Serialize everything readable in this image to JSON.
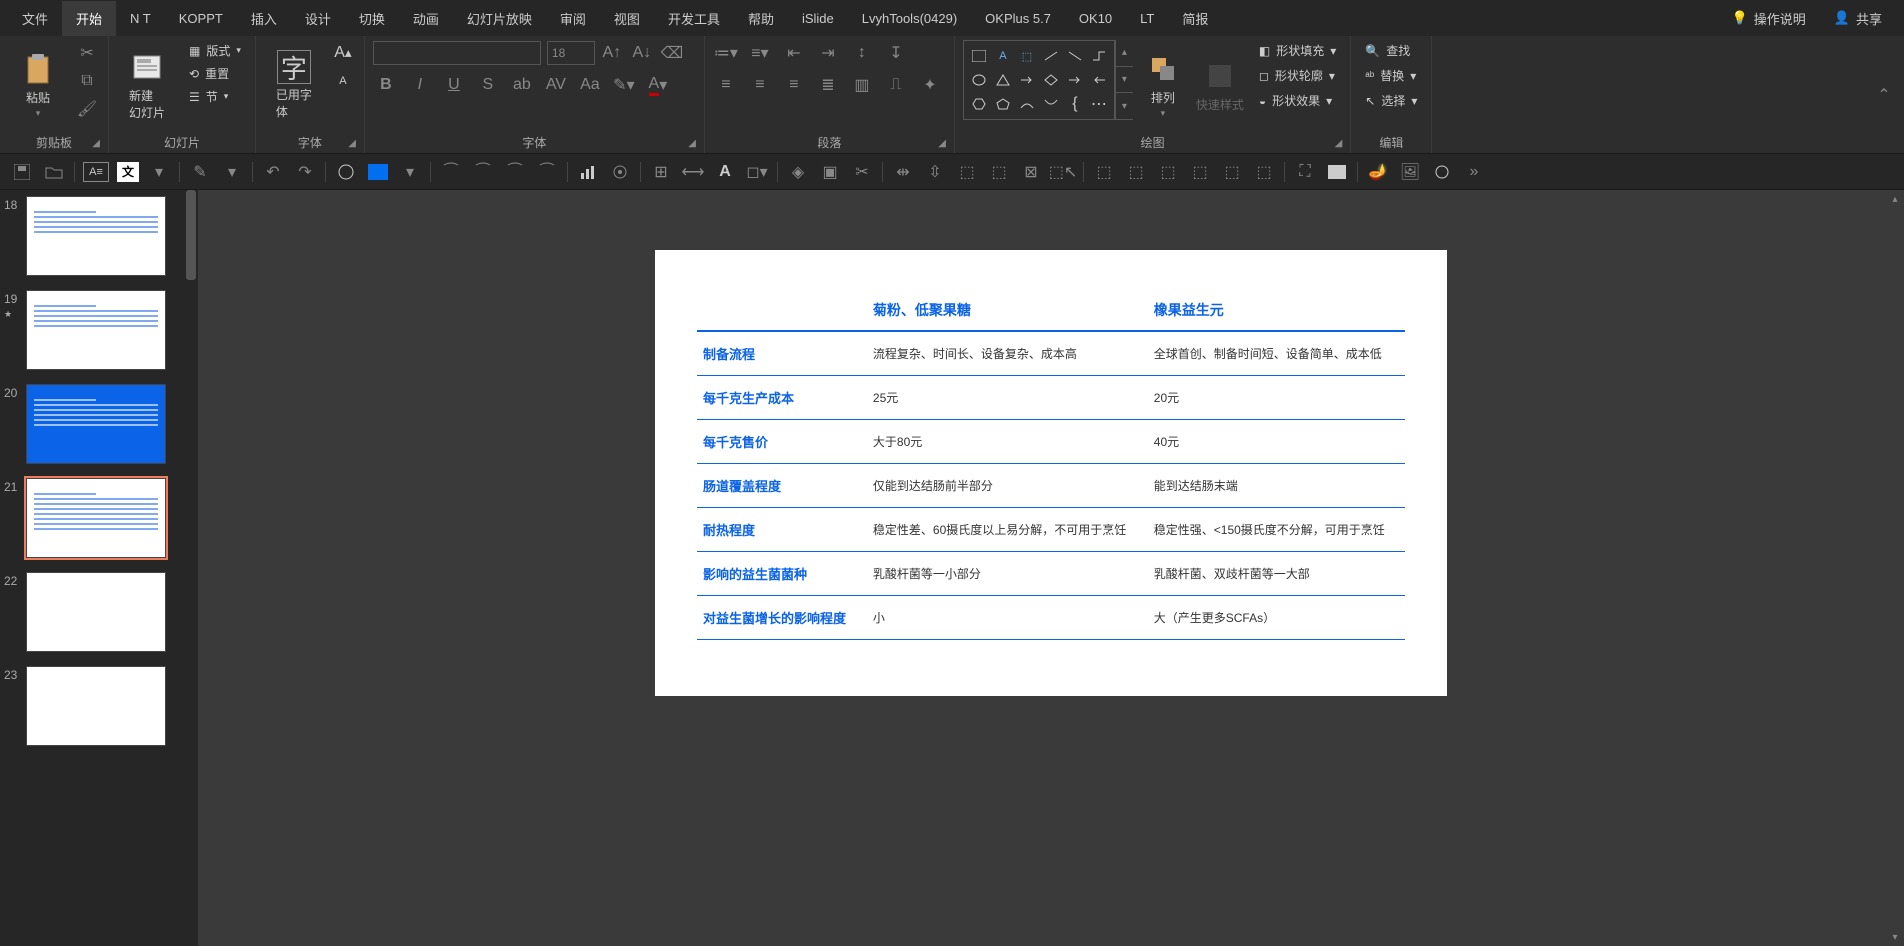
{
  "menubar": {
    "items": [
      "文件",
      "开始",
      "N T",
      "KOPPT",
      "插入",
      "设计",
      "切换",
      "动画",
      "幻灯片放映",
      "审阅",
      "视图",
      "开发工具",
      "帮助",
      "iSlide",
      "LvyhTools(0429)",
      "OKPlus 5.7",
      "OK10",
      "LT",
      "简报"
    ],
    "active_index": 1,
    "right": {
      "help": "操作说明",
      "share": "共享"
    }
  },
  "ribbon": {
    "clipboard": {
      "paste": "粘贴",
      "label": "剪贴板"
    },
    "slides": {
      "new_slide": "新建\n幻灯片",
      "layout": "版式",
      "reset": "重置",
      "section": "节",
      "label": "幻灯片"
    },
    "font_used": {
      "label_btn": "已用字\n体",
      "group_label": "字体"
    },
    "font": {
      "size": "18",
      "group_label": "字体"
    },
    "paragraph": {
      "label": "段落"
    },
    "drawing": {
      "arrange": "排列",
      "quick_style": "快速样式",
      "fill": "形状填充",
      "outline": "形状轮廓",
      "effects": "形状效果",
      "label": "绘图"
    },
    "editing": {
      "find": "查找",
      "replace": "替换",
      "select": "选择",
      "label": "编辑"
    }
  },
  "thumbnails": [
    {
      "num": "18",
      "variant": "white"
    },
    {
      "num": "19",
      "variant": "white"
    },
    {
      "num": "20",
      "variant": "blue"
    },
    {
      "num": "21",
      "variant": "white",
      "selected": true
    },
    {
      "num": "22",
      "variant": "blank"
    },
    {
      "num": "23",
      "variant": "blank"
    }
  ],
  "slide_table": {
    "headers": [
      "",
      "菊粉、低聚果糖",
      "橡果益生元"
    ],
    "rows": [
      [
        "制备流程",
        "流程复杂、时间长、设备复杂、成本高",
        "全球首创、制备时间短、设备简单、成本低"
      ],
      [
        "每千克生产成本",
        "25元",
        "20元"
      ],
      [
        "每千克售价",
        "大于80元",
        "40元"
      ],
      [
        "肠道覆盖程度",
        "仅能到达结肠前半部分",
        "能到达结肠末端"
      ],
      [
        "耐热程度",
        "稳定性差、60摄氏度以上易分解，不可用于烹饪",
        "稳定性强、<150摄氏度不分解，可用于烹饪"
      ],
      [
        "影响的益生菌菌种",
        "乳酸杆菌等一小部分",
        "乳酸杆菌、双歧杆菌等一大部"
      ],
      [
        "对益生菌增长的影响程度",
        "小",
        "大（产生更多SCFAs）"
      ]
    ]
  }
}
